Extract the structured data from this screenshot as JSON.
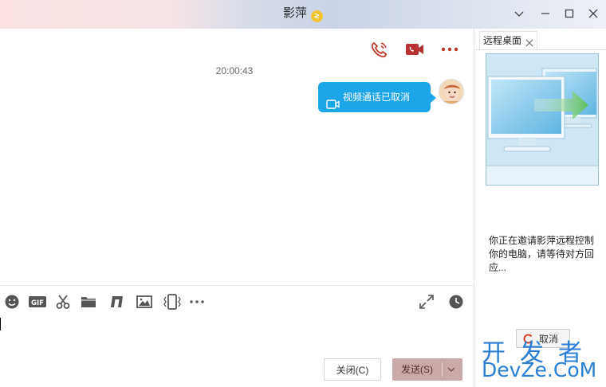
{
  "window": {
    "title": "影萍",
    "vip_badge": "≥",
    "controls": [
      "chevron-down-icon",
      "minimize-icon",
      "maximize-icon",
      "close-icon"
    ]
  },
  "call_tools": {
    "items": [
      {
        "icon": "phone-icon",
        "color": "#c0392b"
      },
      {
        "icon": "video-camera-icon",
        "color": "#b83232"
      },
      {
        "icon": "more-icon",
        "color": "#c0392b"
      }
    ]
  },
  "chat": {
    "timestamp": "20:00:43",
    "messages": [
      {
        "text": "视频通话已取消",
        "icon": "video-camera-icon",
        "bubble_color": "#1aa6e8"
      }
    ]
  },
  "input_toolbar": {
    "icons": [
      "emoji-icon",
      "gif-icon",
      "scissors-icon",
      "folder-icon",
      "music-icon",
      "image-icon",
      "shake-icon",
      "more-icon",
      "expand-icon",
      "history-clock-icon"
    ],
    "gif_label": "GIF"
  },
  "buttons": {
    "close_label": "关闭(C)",
    "send_label": "发送(S)",
    "send_color": "#c9a9a8"
  },
  "side_panel": {
    "tab_label": "远程桌面",
    "message": "你正在邀请影萍远程控制你的电脑，请等待对方回应...",
    "cancel_label": "取消"
  },
  "watermark": {
    "line1": "开发者",
    "line2": "DevZe.CoM"
  }
}
